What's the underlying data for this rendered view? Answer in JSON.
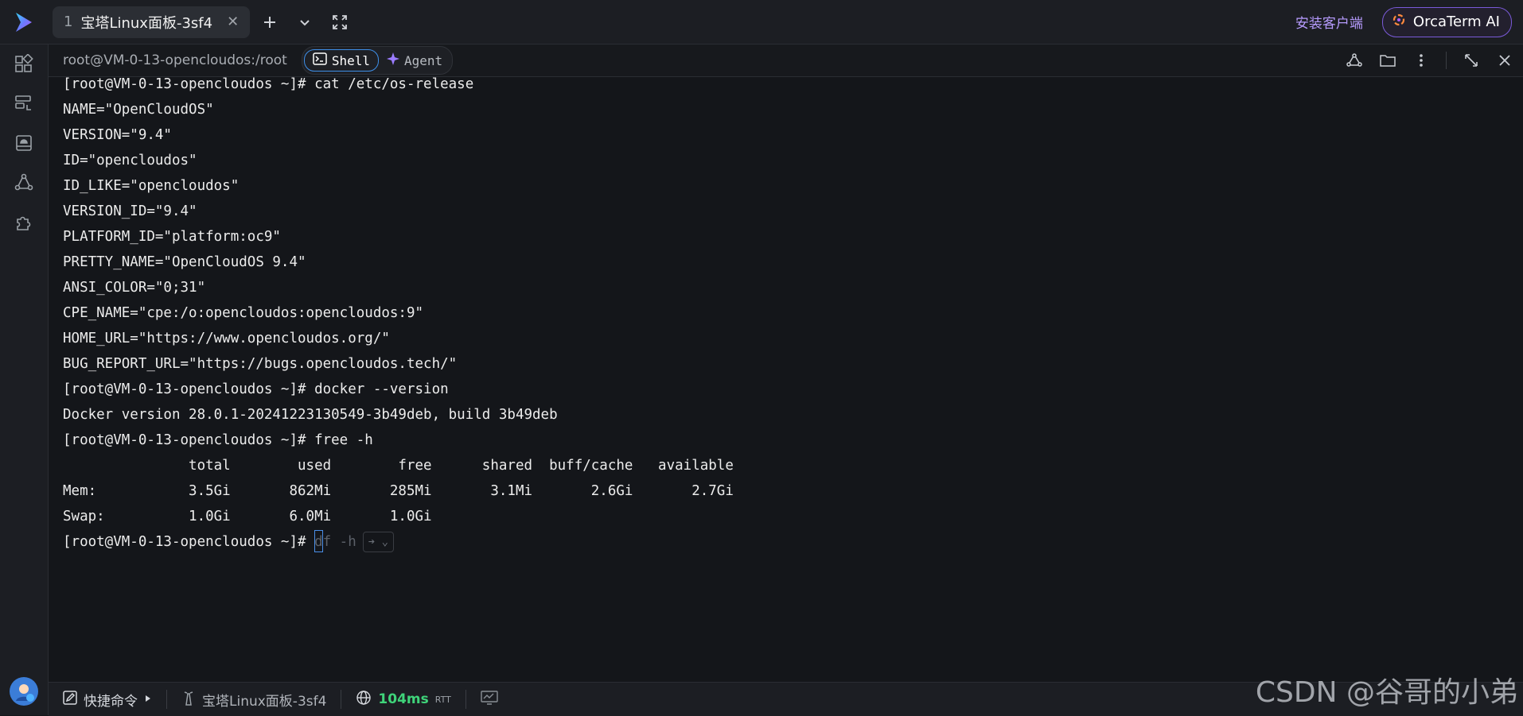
{
  "titlebar": {
    "tab_number": "1",
    "tab_title": "宝塔Linux面板-3sf4",
    "tab_close": "✕",
    "install_client": "安装客户端",
    "orca_label": "OrcaTerm AI"
  },
  "session": {
    "path": "root@VM-0-13-opencloudos:/root",
    "mode_shell": "Shell",
    "mode_agent": "Agent"
  },
  "terminal": {
    "lines": [
      "[root@VM-0-13-opencloudos ~]# cat /etc/os-release",
      "NAME=\"OpenCloudOS\"",
      "VERSION=\"9.4\"",
      "ID=\"opencloudos\"",
      "ID_LIKE=\"opencloudos\"",
      "VERSION_ID=\"9.4\"",
      "PLATFORM_ID=\"platform:oc9\"",
      "PRETTY_NAME=\"OpenCloudOS 9.4\"",
      "ANSI_COLOR=\"0;31\"",
      "CPE_NAME=\"cpe:/o:opencloudos:opencloudos:9\"",
      "HOME_URL=\"https://www.opencloudos.org/\"",
      "BUG_REPORT_URL=\"https://bugs.opencloudos.tech/\"",
      "[root@VM-0-13-opencloudos ~]# docker --version",
      "Docker version 28.0.1-20241223130549-3b49deb, build 3b49deb",
      "[root@VM-0-13-opencloudos ~]# free -h",
      "               total        used        free      shared  buff/cache   available",
      "Mem:           3.5Gi       862Mi       285Mi       3.1Mi       2.6Gi       2.7Gi",
      "Swap:          1.0Gi       6.0Mi       1.0Gi"
    ],
    "prompt": "[root@VM-0-13-opencloudos ~]# ",
    "ghost_suggestion": "df -h",
    "accept_hint": "➔ ⌄"
  },
  "statusbar": {
    "quick_commands": "快捷命令",
    "server_name": "宝塔Linux面板-3sf4",
    "latency": "104ms",
    "latency_unit": "RTT"
  },
  "watermark": "CSDN @谷哥的小弟",
  "colors": {
    "accent_blue": "#3e8fe8",
    "accent_purple": "#7a5ad8",
    "latency_green": "#3fd47a",
    "background": "#14161a"
  }
}
